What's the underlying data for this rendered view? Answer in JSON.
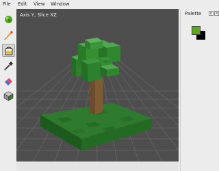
{
  "menubar": {
    "items": [
      {
        "label": "File"
      },
      {
        "label": "Edit"
      },
      {
        "label": "View"
      },
      {
        "label": "Window"
      }
    ]
  },
  "toolbar": {
    "tools": [
      {
        "icon": "brush-icon",
        "active": false
      },
      {
        "icon": "pencil-icon",
        "active": false
      },
      {
        "icon": "fill-bucket-icon",
        "active": true
      },
      {
        "icon": "color-picker-icon",
        "active": false
      },
      {
        "icon": "eraser-icon",
        "active": false
      },
      {
        "icon": "cube-icon",
        "active": false
      }
    ]
  },
  "viewport": {
    "title": "Axis Y, Slice XZ",
    "background_color": "#4e4e4e",
    "grid_color": "#6c6c6c"
  },
  "palette": {
    "title": "Palette",
    "foreground_color": "#5aa81b",
    "background_color": "#000000"
  }
}
